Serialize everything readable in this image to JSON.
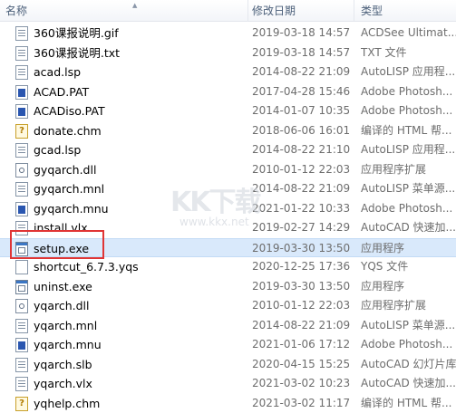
{
  "header": {
    "name": "名称",
    "date": "修改日期",
    "type": "类型"
  },
  "files": [
    {
      "name": "360课报说明.gif",
      "date": "2019-03-18 14:57",
      "type": "ACDSee Ultimat...",
      "icon": "gif-file-icon"
    },
    {
      "name": "360课报说明.txt",
      "date": "2019-03-18 14:57",
      "type": "TXT 文件",
      "icon": "text-file-icon"
    },
    {
      "name": "acad.lsp",
      "date": "2014-08-22 21:09",
      "type": "AutoLISP 应用程...",
      "icon": "lisp-file-icon"
    },
    {
      "name": "ACAD.PAT",
      "date": "2017-04-28 15:46",
      "type": "Adobe Photosh...",
      "icon": "pattern-file-icon"
    },
    {
      "name": "ACADiso.PAT",
      "date": "2014-01-07 10:35",
      "type": "Adobe Photosh...",
      "icon": "pattern-file-icon"
    },
    {
      "name": "donate.chm",
      "date": "2018-06-06 16:01",
      "type": "编译的 HTML 帮...",
      "icon": "help-file-icon"
    },
    {
      "name": "gcad.lsp",
      "date": "2014-08-22 21:10",
      "type": "AutoLISP 应用程...",
      "icon": "lisp-file-icon"
    },
    {
      "name": "gyqarch.dll",
      "date": "2010-01-12 22:03",
      "type": "应用程序扩展",
      "icon": "dll-file-icon"
    },
    {
      "name": "gyqarch.mnl",
      "date": "2014-08-22 21:09",
      "type": "AutoLISP 菜单源...",
      "icon": "lisp-file-icon"
    },
    {
      "name": "gyqarch.mnu",
      "date": "2021-01-22 10:33",
      "type": "Adobe Photosh...",
      "icon": "pattern-file-icon"
    },
    {
      "name": "install.vlx",
      "date": "2019-02-27 14:29",
      "type": "AutoCAD 快速加...",
      "icon": "lisp-file-icon"
    },
    {
      "name": "setup.exe",
      "date": "2019-03-30 13:50",
      "type": "应用程序",
      "icon": "exe-file-icon",
      "selected": true
    },
    {
      "name": "shortcut_6.7.3.yqs",
      "date": "2020-12-25 17:36",
      "type": "YQS 文件",
      "icon": "blank-file-icon"
    },
    {
      "name": "uninst.exe",
      "date": "2019-03-30 13:50",
      "type": "应用程序",
      "icon": "exe-file-icon"
    },
    {
      "name": "yqarch.dll",
      "date": "2010-01-12 22:03",
      "type": "应用程序扩展",
      "icon": "dll-file-icon"
    },
    {
      "name": "yqarch.mnl",
      "date": "2014-08-22 21:09",
      "type": "AutoLISP 菜单源...",
      "icon": "lisp-file-icon"
    },
    {
      "name": "yqarch.mnu",
      "date": "2021-01-06 17:12",
      "type": "Adobe Photosh...",
      "icon": "pattern-file-icon"
    },
    {
      "name": "yqarch.slb",
      "date": "2020-04-15 15:25",
      "type": "AutoCAD 幻灯片库",
      "icon": "lisp-file-icon"
    },
    {
      "name": "yqarch.vlx",
      "date": "2021-03-02 10:23",
      "type": "AutoCAD 快速加...",
      "icon": "lisp-file-icon"
    },
    {
      "name": "yqhelp.chm",
      "date": "2021-03-02 11:17",
      "type": "编译的 HTML 帮...",
      "icon": "help-file-icon"
    }
  ],
  "watermark": {
    "logo": "KK下载",
    "url": "www.kkx.net"
  },
  "colors": {
    "selected_row": "#d9e9fb",
    "highlight_border": "#e03535",
    "header_text": "#4c607a"
  }
}
